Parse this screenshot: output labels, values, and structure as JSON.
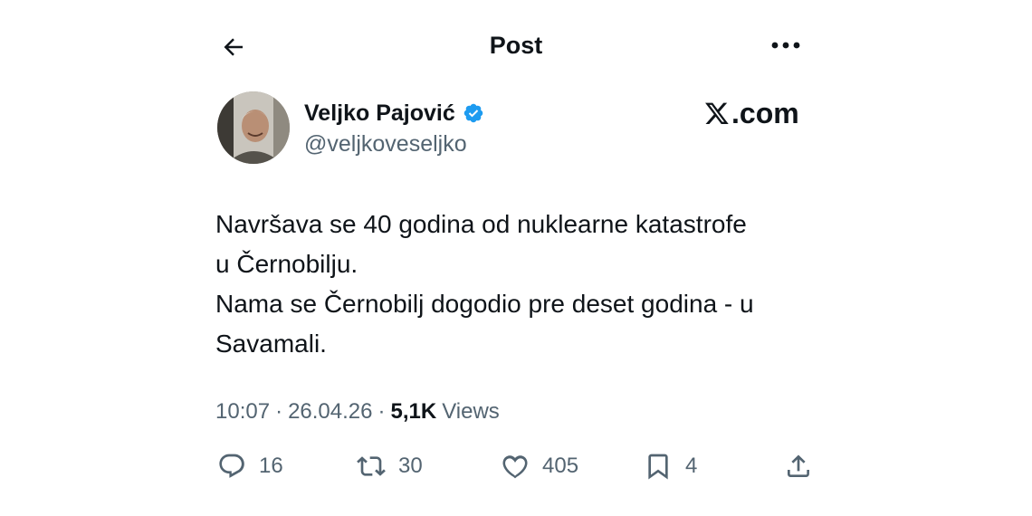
{
  "header": {
    "title": "Post",
    "back_icon": "arrow-left-icon",
    "more_icon": "more-horizontal-icon"
  },
  "author": {
    "display_name": "Veljko Pajović",
    "handle": "@veljkoveseljko",
    "verified": true,
    "verified_color": "#1d9bf0"
  },
  "brand": {
    "suffix": ".com"
  },
  "tweet": {
    "lines": [
      "Navršava se 40 godina od nuklearne katastrofe",
      "u Černobilju.",
      "Nama se Černobilj dogodio pre deset godina - u",
      "Savamali."
    ]
  },
  "meta": {
    "time": "10:07",
    "date": "26.04.26",
    "separator": "·",
    "views_count": "5,1K",
    "views_label": "Views"
  },
  "actions": {
    "replies": "16",
    "reposts": "30",
    "likes": "405",
    "bookmarks": "4"
  },
  "colors": {
    "text": "#0f1419",
    "secondary": "#536471",
    "accent": "#1d9bf0"
  }
}
